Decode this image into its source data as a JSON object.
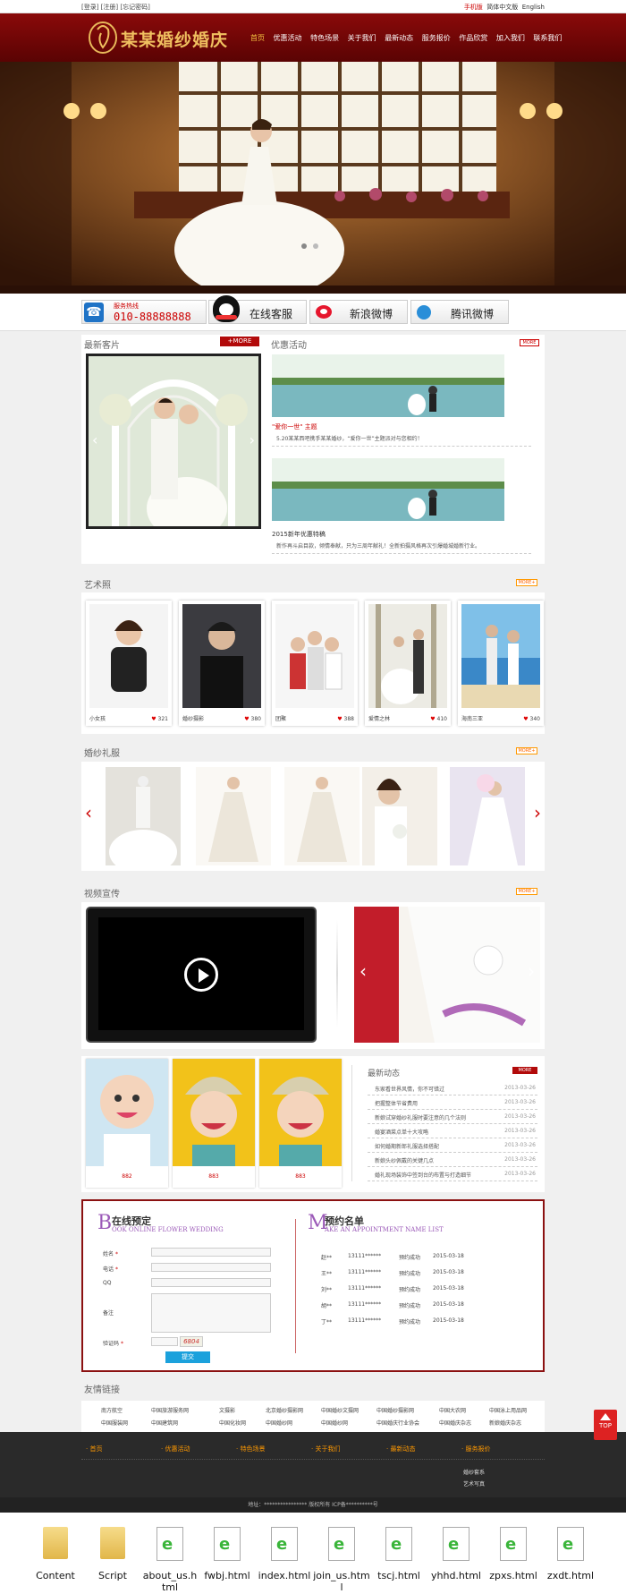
{
  "topbar": {
    "left": "[登录]  [注册]  [忘记密码]",
    "mobile": "手机版",
    "lang_cn": "简体中文版",
    "lang_en": "English"
  },
  "brand": {
    "name": "某某婚纱婚庆"
  },
  "nav": [
    "首页",
    "优惠活动",
    "特色场景",
    "关于我们",
    "最新动态",
    "服务报价",
    "作品欣赏",
    "加入我们",
    "联系我们"
  ],
  "service": {
    "hotline_label": "服务热线",
    "hotline": "010-88888888",
    "online": "在线客服",
    "sina": "新浪微博",
    "tencent": "腾讯微博"
  },
  "latest_clients": {
    "title": "最新客片",
    "more": "+MORE"
  },
  "promotions": {
    "title": "优惠活动",
    "more": "MORE",
    "items": [
      {
        "title": "\"爱你一世\" 主题",
        "desc": "5.20某某西吧携手某某婚纱，“爱你一世”主题派对与您相约！"
      },
      {
        "title": "2015新年优惠特稿",
        "desc": "新作再斗启目款，倾情奉献，只为三周年献礼！全新拍摄风格再次引爆婚城婚新行业。"
      }
    ]
  },
  "art_photos": {
    "title": "艺术照",
    "more": "MORE+",
    "items": [
      {
        "name": "小女孩",
        "likes": "321"
      },
      {
        "name": "婚纱摄影",
        "likes": "380"
      },
      {
        "name": "团聚",
        "likes": "388"
      },
      {
        "name": "爱情之林",
        "likes": "410"
      },
      {
        "name": "海南三亚",
        "likes": "340"
      }
    ]
  },
  "dresses": {
    "title": "婚纱礼服",
    "more": "MORE+"
  },
  "video": {
    "title": "视频宣传",
    "more": "MORE+"
  },
  "babies": {
    "items": [
      "882",
      "883",
      "883"
    ]
  },
  "news": {
    "title": "最新动态",
    "more": "MORE",
    "items": [
      {
        "title": "东家看世界风情，你不可错过",
        "date": "2013-03-26"
      },
      {
        "title": "把握整体节省费用",
        "date": "2013-03-26"
      },
      {
        "title": "新娘试穿婚纱礼服时要注意的几个法则",
        "date": "2013-03-26"
      },
      {
        "title": "婚宴酒菜点单十大攻略",
        "date": "2013-03-26"
      },
      {
        "title": "如何婚期新郎礼服选择搭配",
        "date": "2013-03-26"
      },
      {
        "title": "新娘头纱佩戴的关键几点",
        "date": "2013-03-26"
      },
      {
        "title": "婚礼现场装饰中签到台的布置与打造细节",
        "date": "2013-03-26"
      }
    ]
  },
  "booking": {
    "title": "在线预定",
    "subtitle": "OOK ONLINE FLOWER WEDDING",
    "big_letter": "B",
    "fields": {
      "name": "姓名",
      "phone": "电话",
      "qq": "QQ",
      "note": "备注",
      "captcha": "验证码"
    },
    "captcha_code": "6804",
    "submit": "提交"
  },
  "appointments": {
    "title": "预约名单",
    "subtitle": "AKE AN APPOINTMENT NAME LIST",
    "big_letter": "M",
    "rows": [
      {
        "name": "赵**",
        "phone": "13111******",
        "status": "预约成功",
        "date": "2015-03-18"
      },
      {
        "name": "王**",
        "phone": "13111******",
        "status": "预约成功",
        "date": "2015-03-18"
      },
      {
        "name": "刘**",
        "phone": "13111******",
        "status": "预约成功",
        "date": "2015-03-18"
      },
      {
        "name": "胡**",
        "phone": "13111******",
        "status": "预约成功",
        "date": "2015-03-18"
      },
      {
        "name": "丁**",
        "phone": "13111******",
        "status": "预约成功",
        "date": "2015-03-18"
      }
    ]
  },
  "friend_links": {
    "title": "友情链接",
    "items": [
      "南方航空",
      "中国旅游服务网",
      "文摄影",
      "北京婚纱摄影网",
      "中国婚纱文摄网",
      "中国婚纱摄影网",
      "中国大农网",
      "中国泳上用品网",
      "中国服装网",
      "中国建筑网",
      "中国化妆网",
      "中国婚纱网",
      "中国婚纱网",
      "中国婚庆行业协会",
      "中国婚庆杂志",
      "新娘婚庆杂志"
    ]
  },
  "footer": {
    "cols": [
      "首页",
      "优惠活动",
      "特色场景",
      "关于我们",
      "最新动态",
      "服务报价"
    ],
    "subs": [
      "婚纱套系",
      "艺术写真"
    ],
    "copyright": "地址：**************** 版权所有 ICP备**********号"
  },
  "top_button": "TOP",
  "files": [
    "Content",
    "Script",
    "about_us.html",
    "fwbj.html",
    "index.html",
    "join_us.html",
    "tscj.html",
    "yhhd.html",
    "zpxs.html",
    "zxdt.html"
  ],
  "colors": {
    "brand": "#7a0808",
    "accent": "#f90",
    "highlight": "#c00"
  }
}
